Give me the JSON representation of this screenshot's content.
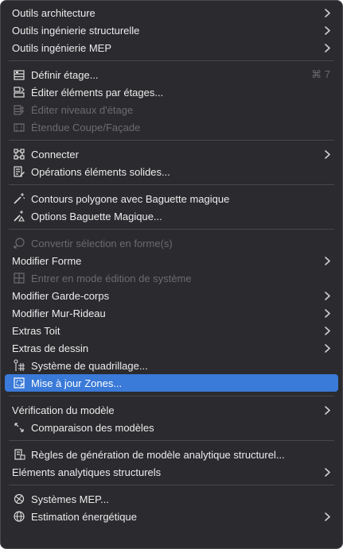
{
  "menu": {
    "architecture_tools": "Outils architecture",
    "structural_tools": "Outils ingénierie structurelle",
    "mep_tools": "Outils ingénierie MEP",
    "define_story": "Définir étage...",
    "define_story_shortcut": "⌘ 7",
    "edit_by_stories": "Éditer éléments par étages...",
    "edit_levels": "Éditer niveaux d'étage",
    "section_extent": "Étendue Coupe/Façade",
    "connect": "Connecter",
    "solid_ops": "Opérations éléments solides...",
    "magic_wand_polygon": "Contours polygone avec Baguette magique",
    "magic_wand_options": "Options Baguette Magique...",
    "convert_selection": "Convertir sélection en forme(s)",
    "modify_shape": "Modifier Forme",
    "system_edit_mode": "Entrer en mode édition de système",
    "modify_railing": "Modifier Garde-corps",
    "modify_curtain_wall": "Modifier Mur-Rideau",
    "roof_extras": "Extras Toit",
    "drawing_extras": "Extras de dessin",
    "grid_system": "Système de quadrillage...",
    "update_zones": "Mise à jour Zones...",
    "model_check": "Vérification du modèle",
    "model_compare": "Comparaison des modèles",
    "analytical_rules": "Règles de génération de modèle analytique structurel...",
    "analytical_elements": "Eléments analytiques structurels",
    "mep_systems": "Systèmes MEP...",
    "energy_estimate": "Estimation énergétique"
  },
  "colors": {
    "background": "#2b2a2e",
    "highlight": "#3a7ad8",
    "text": "#ececec",
    "disabled_text": "#6c6b70"
  }
}
